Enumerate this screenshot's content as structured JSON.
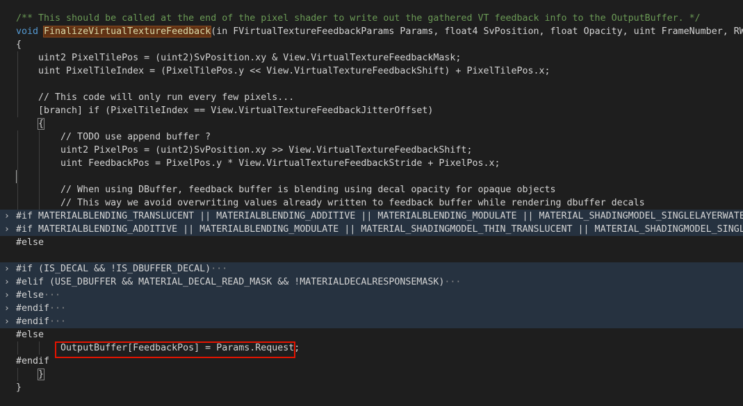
{
  "editor": {
    "lines": [
      {
        "fold": "",
        "indent": 0,
        "guides": [],
        "folded": false,
        "tokens": [
          {
            "t": "/** This should be called at the end of the pixel shader to write out the gathered VT feedback info to the OutputBuffer. */",
            "c": "comment"
          }
        ]
      },
      {
        "fold": "",
        "indent": 0,
        "guides": [],
        "folded": false,
        "tokens": [
          {
            "t": "void ",
            "c": "keyword"
          },
          {
            "t": "FinalizeVirtualTextureFeedback",
            "c": "func-hl"
          },
          {
            "t": "(in FVirtualTextureFeedbackParams Params, float4 SvPosition, float Opacity, uint FrameNumber, RWStruc",
            "c": "text"
          }
        ]
      },
      {
        "fold": "",
        "indent": 0,
        "guides": [],
        "folded": false,
        "tokens": [
          {
            "t": "{",
            "c": "text"
          }
        ]
      },
      {
        "fold": "",
        "indent": 0,
        "guides": [
          1
        ],
        "folded": false,
        "tokens": [
          {
            "t": "    uint2 PixelTilePos = (uint2)SvPosition.xy & View.VirtualTextureFeedbackMask;",
            "c": "text"
          }
        ]
      },
      {
        "fold": "",
        "indent": 0,
        "guides": [
          1
        ],
        "folded": false,
        "tokens": [
          {
            "t": "    uint PixelTileIndex = (PixelTilePos.y << View.VirtualTextureFeedbackShift) + PixelTilePos.x;",
            "c": "text"
          }
        ]
      },
      {
        "fold": "",
        "indent": 0,
        "guides": [
          1
        ],
        "folded": false,
        "tokens": [
          {
            "t": "",
            "c": "text"
          }
        ]
      },
      {
        "fold": "",
        "indent": 0,
        "guides": [
          1
        ],
        "folded": false,
        "tokens": [
          {
            "t": "    // This code will only run every few pixels...",
            "c": "text"
          }
        ]
      },
      {
        "fold": "",
        "indent": 0,
        "guides": [
          1
        ],
        "folded": false,
        "tokens": [
          {
            "t": "    [branch] if (PixelTileIndex == View.VirtualTextureFeedbackJitterOffset)",
            "c": "text"
          }
        ]
      },
      {
        "fold": "",
        "indent": 0,
        "guides": [],
        "folded": false,
        "bracket": true,
        "tokens": [
          {
            "t": "    {",
            "c": "text"
          }
        ]
      },
      {
        "fold": "",
        "indent": 0,
        "guides": [
          1,
          2
        ],
        "folded": false,
        "tokens": [
          {
            "t": "        // TODO use append buffer ?",
            "c": "text"
          }
        ]
      },
      {
        "fold": "",
        "indent": 0,
        "guides": [
          1,
          2
        ],
        "folded": false,
        "tokens": [
          {
            "t": "        uint2 PixelPos = (uint2)SvPosition.xy >> View.VirtualTextureFeedbackShift;",
            "c": "text"
          }
        ]
      },
      {
        "fold": "",
        "indent": 0,
        "guides": [
          1,
          2
        ],
        "folded": false,
        "tokens": [
          {
            "t": "        uint FeedbackPos = PixelPos.y * View.VirtualTextureFeedbackStride + PixelPos.x;",
            "c": "text"
          }
        ]
      },
      {
        "fold": "",
        "indent": 0,
        "guides": [
          1,
          2
        ],
        "folded": false,
        "cursor": true,
        "tokens": [
          {
            "t": "",
            "c": "text"
          }
        ]
      },
      {
        "fold": "",
        "indent": 0,
        "guides": [
          1,
          2
        ],
        "folded": false,
        "tokens": [
          {
            "t": "        // When using DBuffer, feedback buffer is blending using decal opacity for opaque objects",
            "c": "text"
          }
        ]
      },
      {
        "fold": "",
        "indent": 0,
        "guides": [
          1,
          2
        ],
        "folded": false,
        "tokens": [
          {
            "t": "        // This way we avoid overwriting values already written to feedback buffer while rendering dbuffer decals",
            "c": "text"
          }
        ]
      },
      {
        "fold": "›",
        "indent": 0,
        "guides": [],
        "folded": true,
        "tokens": [
          {
            "t": "#if MATERIALBLENDING_TRANSLUCENT || MATERIALBLENDING_ADDITIVE || MATERIALBLENDING_MODULATE || MATERIAL_SHADINGMODEL_SINGLELAYERWATER || ",
            "c": "text"
          }
        ]
      },
      {
        "fold": "›",
        "indent": 0,
        "guides": [],
        "folded": true,
        "tokens": [
          {
            "t": "#if MATERIALBLENDING_ADDITIVE || MATERIALBLENDING_MODULATE || MATERIAL_SHADINGMODEL_THIN_TRANSLUCENT || MATERIAL_SHADINGMODEL_SINGLELAYE",
            "c": "text"
          }
        ]
      },
      {
        "fold": "",
        "indent": 0,
        "guides": [],
        "folded": false,
        "tokens": [
          {
            "t": "#else",
            "c": "text"
          }
        ]
      },
      {
        "fold": "",
        "indent": 0,
        "guides": [],
        "folded": false,
        "tokens": [
          {
            "t": "",
            "c": "text"
          }
        ]
      },
      {
        "fold": "›",
        "indent": 0,
        "guides": [],
        "folded": true,
        "tokens": [
          {
            "t": "#if (IS_DECAL && !IS_DBUFFER_DECAL)",
            "c": "text"
          },
          {
            "t": "···",
            "c": "ellipsis"
          }
        ]
      },
      {
        "fold": "›",
        "indent": 0,
        "guides": [],
        "folded": true,
        "tokens": [
          {
            "t": "#elif (USE_DBUFFER && MATERIAL_DECAL_READ_MASK && !MATERIALDECALRESPONSEMASK)",
            "c": "text"
          },
          {
            "t": "···",
            "c": "ellipsis"
          }
        ]
      },
      {
        "fold": "›",
        "indent": 0,
        "guides": [],
        "folded": true,
        "tokens": [
          {
            "t": "#else",
            "c": "text"
          },
          {
            "t": "···",
            "c": "ellipsis"
          }
        ]
      },
      {
        "fold": "›",
        "indent": 0,
        "guides": [],
        "folded": true,
        "tokens": [
          {
            "t": "#endif",
            "c": "text"
          },
          {
            "t": "···",
            "c": "ellipsis"
          }
        ]
      },
      {
        "fold": "›",
        "indent": 0,
        "guides": [],
        "folded": true,
        "tokens": [
          {
            "t": "#endif",
            "c": "text"
          },
          {
            "t": "···",
            "c": "ellipsis"
          }
        ]
      },
      {
        "fold": "",
        "indent": 0,
        "guides": [],
        "folded": false,
        "tokens": [
          {
            "t": "#else",
            "c": "text"
          }
        ]
      },
      {
        "fold": "",
        "indent": 0,
        "guides": [
          1,
          2
        ],
        "folded": false,
        "tokens": [
          {
            "t": "        OutputBuffer[FeedbackPos] = Params.Request;",
            "c": "text"
          }
        ]
      },
      {
        "fold": "",
        "indent": 0,
        "guides": [],
        "folded": false,
        "tokens": [
          {
            "t": "#endif",
            "c": "text"
          }
        ]
      },
      {
        "fold": "",
        "indent": 0,
        "guides": [
          1
        ],
        "folded": false,
        "bracket": true,
        "tokens": [
          {
            "t": "    }",
            "c": "text"
          }
        ]
      },
      {
        "fold": "",
        "indent": 0,
        "guides": [],
        "folded": false,
        "tokens": [
          {
            "t": "}",
            "c": "text"
          }
        ]
      }
    ]
  }
}
